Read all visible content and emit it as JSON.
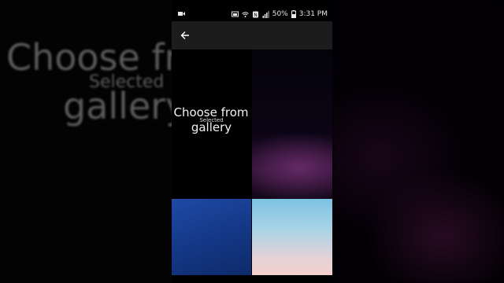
{
  "background": {
    "ghost_line1": "Choose fro",
    "ghost_line2": "Selected",
    "ghost_line3": "gallery"
  },
  "status_bar": {
    "battery": "50%",
    "time": "3:31 PM",
    "icons": [
      "video-icon",
      "cast-icon",
      "wifi-icon",
      "nfc-icon",
      "signal-icon",
      "battery-icon"
    ]
  },
  "app_bar": {
    "back_icon": "arrow-left-icon"
  },
  "grid": {
    "gallery_tile": {
      "line1": "Choose from",
      "line2": "Selected",
      "line3": "gallery"
    },
    "tiles": [
      {
        "name": "purple-wallpaper",
        "color": "#2a1030"
      },
      {
        "name": "blue-wallpaper",
        "color": "#1e4aa6"
      },
      {
        "name": "sky-wallpaper",
        "color": "#7cc3e3"
      }
    ]
  }
}
